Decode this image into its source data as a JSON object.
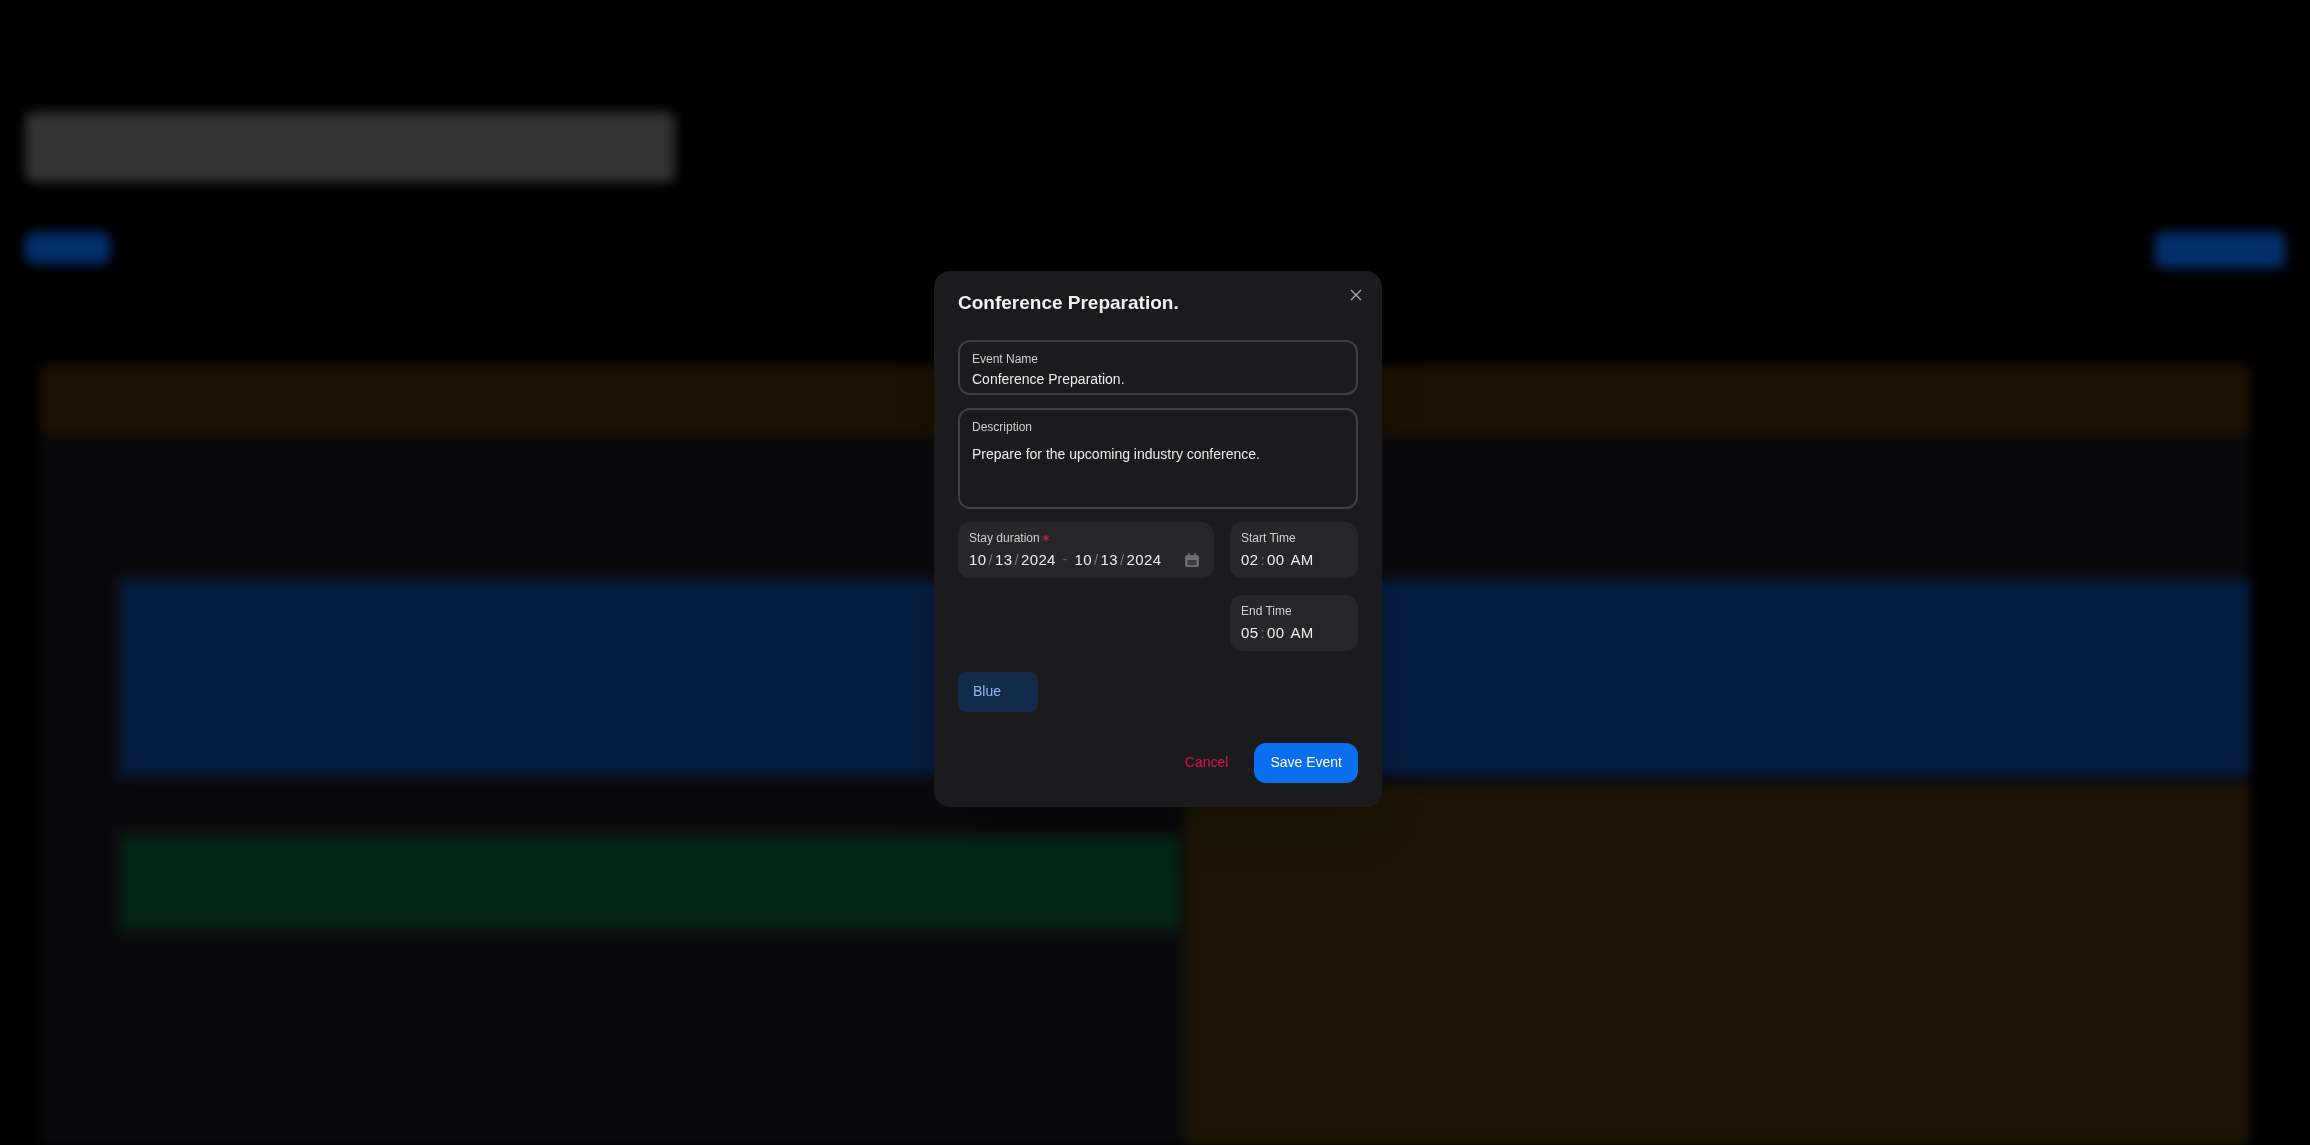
{
  "dialog": {
    "title": "Conference Preparation.",
    "fields": [
      {
        "kind": "text",
        "label": "Event Name",
        "value": "Conference Preparation."
      },
      {
        "kind": "textarea",
        "label": "Description",
        "value": "Prepare for the upcoming industry conference."
      }
    ],
    "date_range": {
      "label": "Stay duration",
      "required": true,
      "start": [
        "10",
        "/",
        "13",
        "/",
        "2024"
      ],
      "dash": "-",
      "end": [
        "10",
        "/",
        "13",
        "/",
        "2024"
      ]
    },
    "times": [
      {
        "label": "Start Time",
        "segments": [
          "02",
          ":",
          "00",
          "AM"
        ]
      },
      {
        "label": "End Time",
        "segments": [
          "05",
          ":",
          "00",
          "AM"
        ]
      }
    ],
    "color_choice": {
      "label": "Blue"
    },
    "buttons": [
      {
        "kind": "cancel",
        "label": "Cancel"
      },
      {
        "kind": "primary",
        "label": "Save Event"
      }
    ]
  }
}
